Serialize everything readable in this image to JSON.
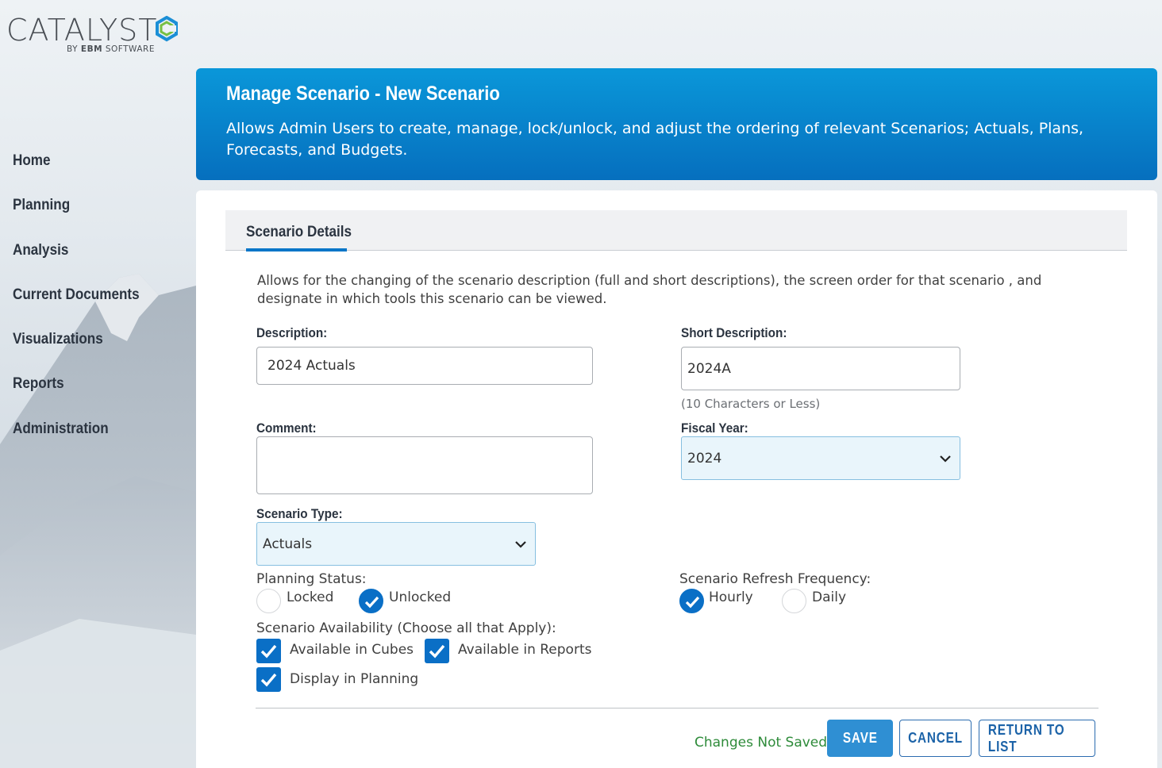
{
  "brand": {
    "name": "CATALYST",
    "byline_prefix": "BY",
    "byline_brand": "EBM",
    "byline_suffix": "SOFTWARE"
  },
  "nav": {
    "items": [
      {
        "label": "Home"
      },
      {
        "label": "Planning"
      },
      {
        "label": "Analysis"
      },
      {
        "label": "Current Documents"
      },
      {
        "label": "Visualizations"
      },
      {
        "label": "Reports"
      },
      {
        "label": "Administration"
      }
    ]
  },
  "header": {
    "title": "Manage Scenario - New Scenario",
    "description": "Allows Admin Users to create, manage, lock/unlock, and adjust the ordering of relevant Scenarios; Actuals, Plans, Forecasts, and Budgets."
  },
  "tabs": {
    "active_label": "Scenario Details"
  },
  "form": {
    "intro": "Allows for the changing of the scenario description (full and short descriptions), the screen order for that scenario , and designate in which tools this scenario can be viewed.",
    "description": {
      "label": "Description:",
      "value": "2024 Actuals"
    },
    "short_description": {
      "label": "Short Description:",
      "value": "2024A",
      "hint": "(10 Characters or Less)"
    },
    "comment": {
      "label": "Comment:",
      "value": ""
    },
    "fiscal_year": {
      "label": "Fiscal Year:",
      "value": "2024"
    },
    "scenario_type": {
      "label": "Scenario Type:",
      "value": "Actuals"
    },
    "planning_status": {
      "label": "Planning Status:",
      "options": [
        {
          "label": "Locked",
          "checked": false
        },
        {
          "label": "Unlocked",
          "checked": true
        }
      ]
    },
    "refresh_frequency": {
      "label": "Scenario Refresh Frequency:",
      "options": [
        {
          "label": "Hourly",
          "checked": true
        },
        {
          "label": "Daily",
          "checked": false
        }
      ]
    },
    "availability": {
      "label": "Scenario Availability (Choose all that Apply):",
      "options": [
        {
          "label": "Available in Cubes",
          "checked": true
        },
        {
          "label": "Available in Reports",
          "checked": true
        },
        {
          "label": "Display in Planning",
          "checked": true
        }
      ]
    }
  },
  "footer": {
    "status": "Changes Not Saved",
    "save_label": "SAVE",
    "cancel_label": "CANCEL",
    "return_label": "RETURN TO LIST"
  },
  "colors": {
    "header_blue": "#066fbe",
    "accent_blue": "#0a6fc6",
    "save_button": "#2f8fd3",
    "status_green": "#2e8b3a"
  }
}
